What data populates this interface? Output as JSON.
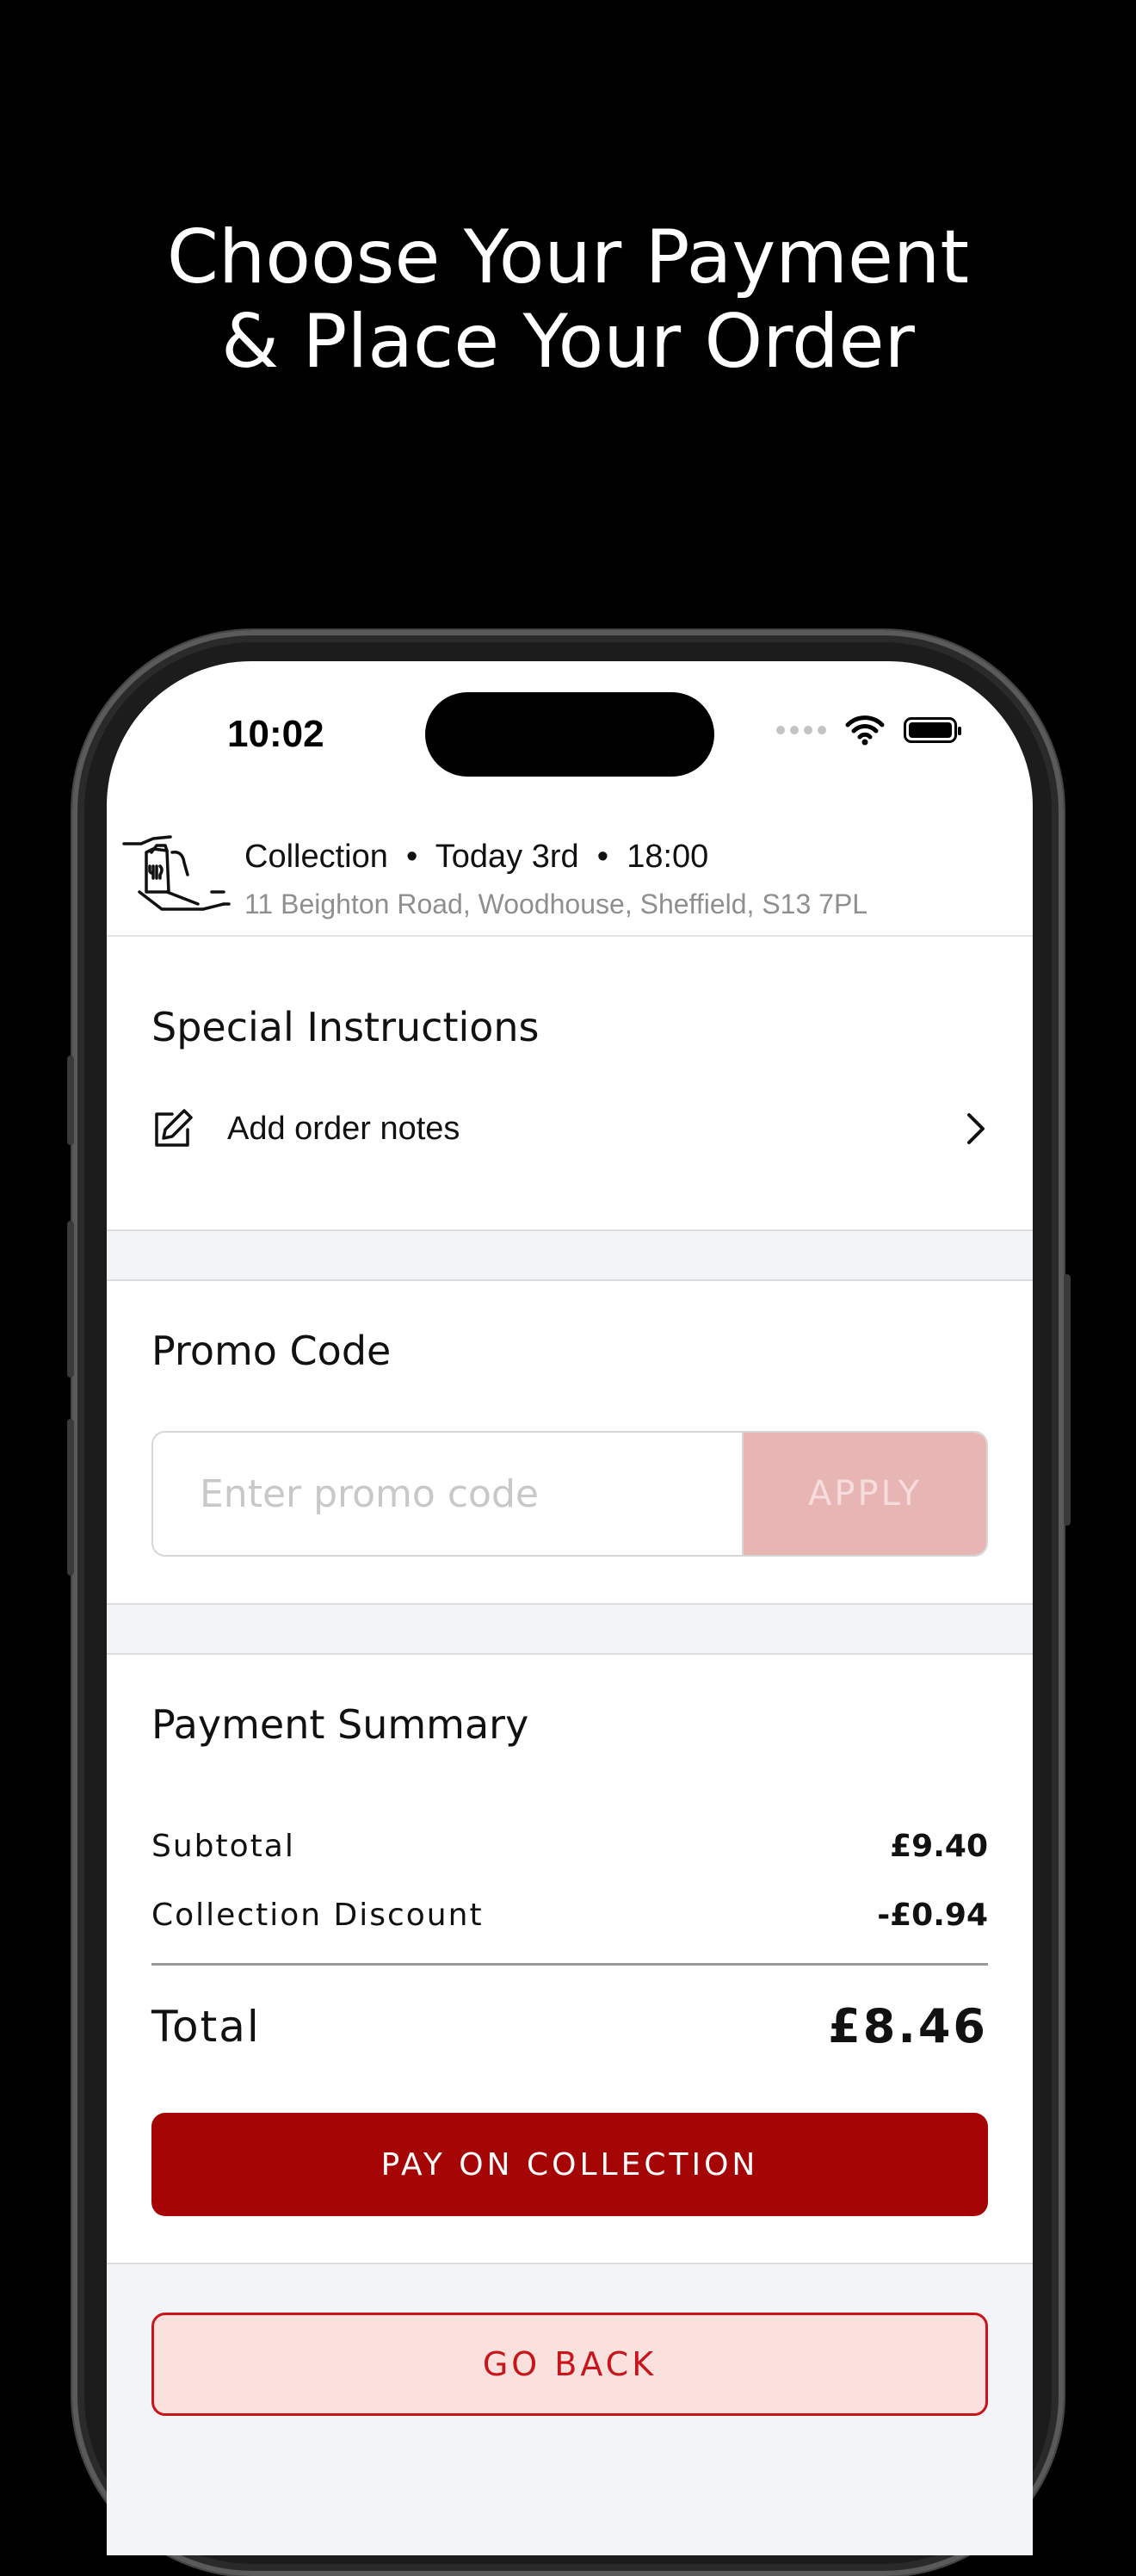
{
  "headline": {
    "line1": "Choose Your Payment",
    "line2": "& Place Your Order"
  },
  "status_bar": {
    "time": "10:02"
  },
  "collection": {
    "mode": "Collection",
    "day": "Today 3rd",
    "time": "18:00",
    "separator": "•",
    "address": "11 Beighton Road, Woodhouse, Sheffield, S13  7PL"
  },
  "special_instructions": {
    "title": "Special Instructions",
    "notes_label": "Add order notes"
  },
  "promo": {
    "title": "Promo Code",
    "placeholder": "Enter promo code",
    "apply_label": "APPLY"
  },
  "payment_summary": {
    "title": "Payment Summary",
    "subtotal_label": "Subtotal",
    "subtotal_value": "£9.40",
    "discount_label": "Collection Discount",
    "discount_value": "-£0.94",
    "total_label": "Total",
    "total_value": "£8.46"
  },
  "actions": {
    "pay_label": "PAY ON COLLECTION",
    "back_label": "GO BACK"
  },
  "colors": {
    "primary": "#a50505",
    "apply_disabled": "#e8b5b5",
    "back_bg": "#fbe1de",
    "back_text": "#c8141b"
  }
}
